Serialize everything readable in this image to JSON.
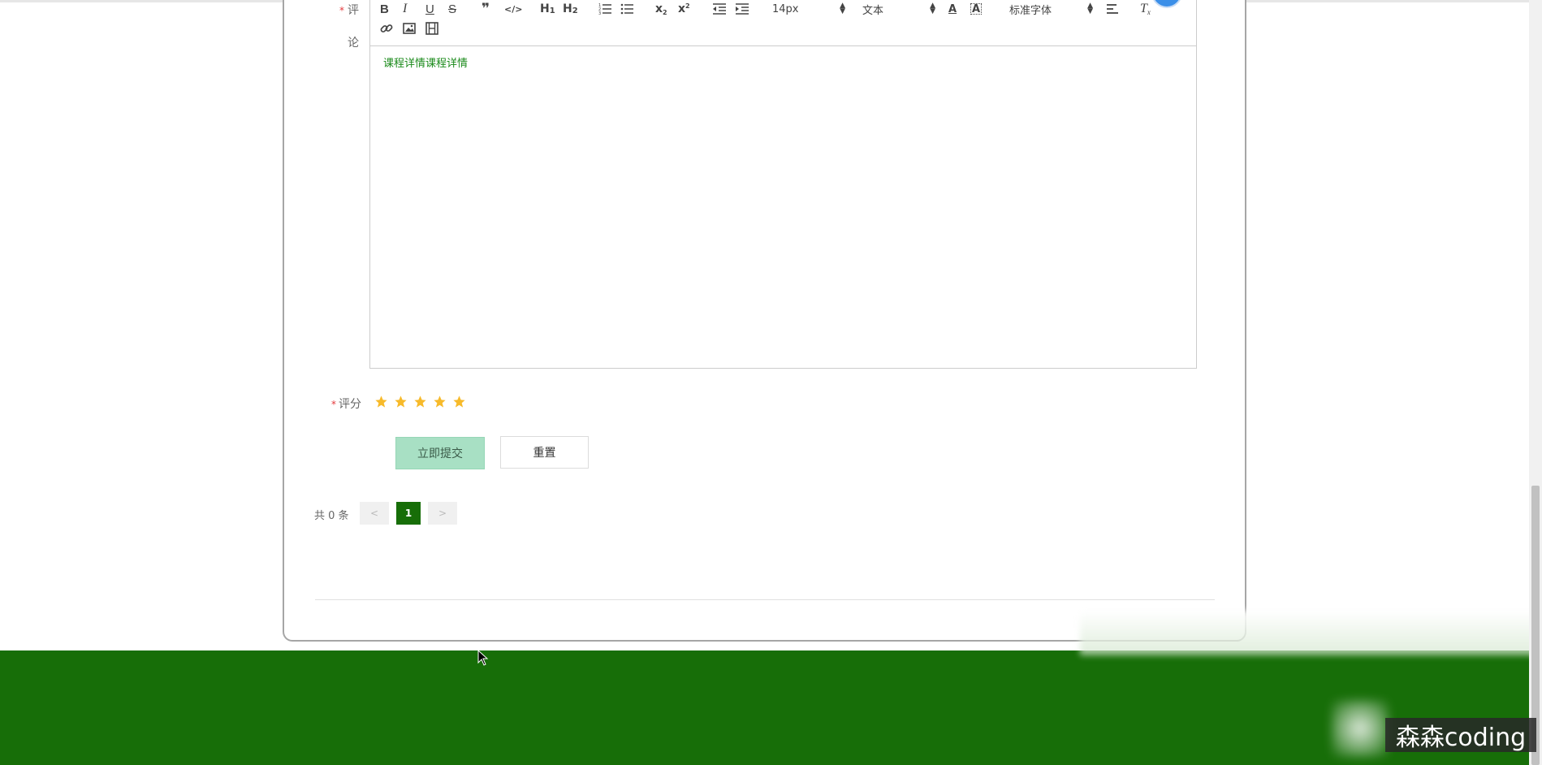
{
  "form": {
    "comment_label_top": "评",
    "comment_label_bottom": "论",
    "required_mark": "*",
    "rating_label": "评分",
    "rating_value": 5,
    "rating_max": 5,
    "submit_label": "立即提交",
    "reset_label": "重置"
  },
  "editor": {
    "content": "课程详情课程详情",
    "font_size": "14px",
    "header_type": "文本",
    "font_family": "标准字体",
    "toolbar_icons": [
      "bold-icon",
      "italic-icon",
      "underline-icon",
      "strikethrough-icon",
      "blockquote-icon",
      "code-block-icon",
      "h1-icon",
      "h2-icon",
      "ordered-list-icon",
      "bullet-list-icon",
      "subscript-icon",
      "superscript-icon",
      "outdent-icon",
      "indent-icon",
      "font-color-icon",
      "background-color-icon",
      "align-icon",
      "clear-format-icon",
      "link-icon",
      "image-icon",
      "video-icon"
    ]
  },
  "pagination": {
    "total_text": "共 0 条",
    "prev": "<",
    "current_page": "1",
    "next": ">"
  },
  "watermark": "森森coding",
  "colors": {
    "footer_green": "#176e08",
    "active_page": "#176e08",
    "star": "#f7ba2a",
    "submit_bg": "#a8e0c4",
    "required": "#e4393c",
    "content_text": "#1a8a1a"
  }
}
